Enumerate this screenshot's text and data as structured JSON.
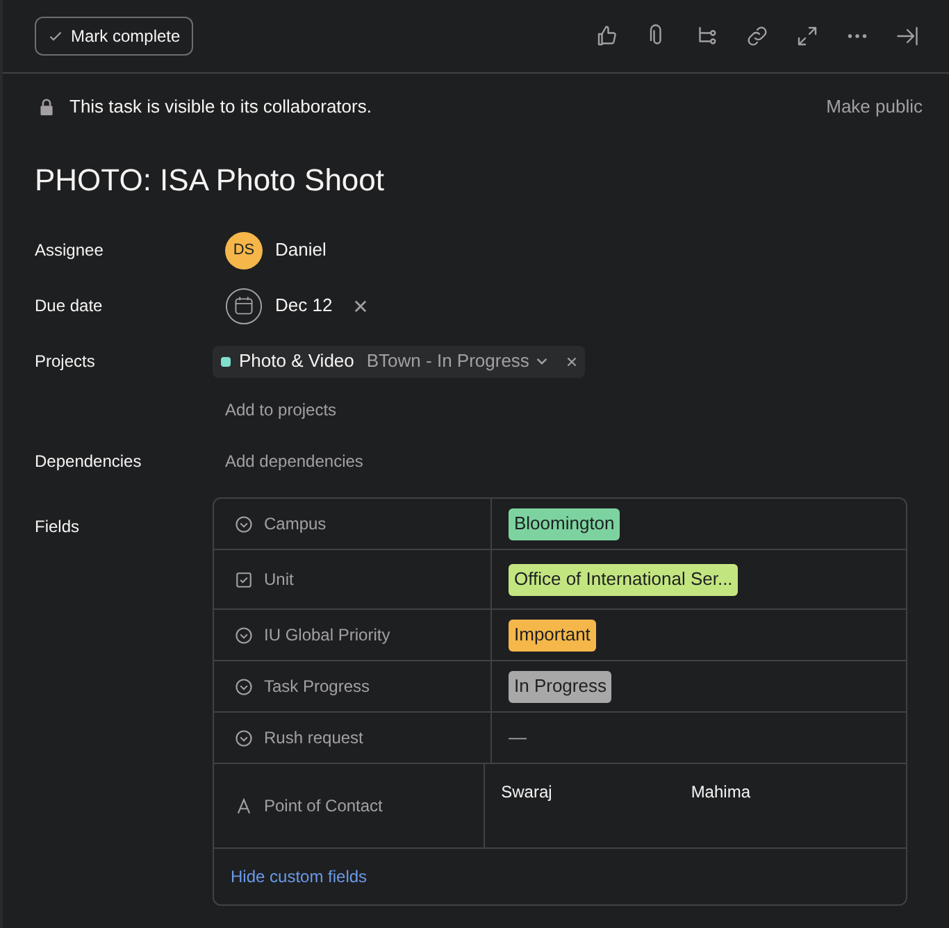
{
  "toolbar": {
    "mark_complete": "Mark complete"
  },
  "privacy": {
    "text": "This task is visible to its collaborators.",
    "action": "Make public"
  },
  "title": "PHOTO: ISA Photo Shoot",
  "assignee": {
    "label": "Assignee",
    "initials": "DS",
    "name": "Daniel"
  },
  "due_date": {
    "label": "Due date",
    "value": "Dec 12"
  },
  "projects": {
    "label": "Projects",
    "items": [
      {
        "name": "Photo & Video",
        "section": "BTown - In Progress",
        "color": "#80e0d0"
      }
    ],
    "add": "Add to projects"
  },
  "dependencies": {
    "label": "Dependencies",
    "add": "Add dependencies"
  },
  "fields": {
    "label": "Fields",
    "rows": [
      {
        "kind": "enum",
        "name": "Campus",
        "value": "Bloomington",
        "color": "#7dd3a0"
      },
      {
        "kind": "multi",
        "name": "Unit",
        "value": "Office of International Ser...",
        "color": "#c3e580"
      },
      {
        "kind": "enum",
        "name": "IU Global Priority",
        "value": "Important",
        "color": "#f5b74a"
      },
      {
        "kind": "enum",
        "name": "Task Progress",
        "value": "In Progress",
        "color": "#a8a8a8"
      },
      {
        "kind": "enum",
        "name": "Rush request",
        "value": "—"
      },
      {
        "kind": "people",
        "name": "Point of Contact",
        "people": [
          "Swaraj",
          "Mahima"
        ]
      }
    ],
    "hide": "Hide custom fields"
  }
}
